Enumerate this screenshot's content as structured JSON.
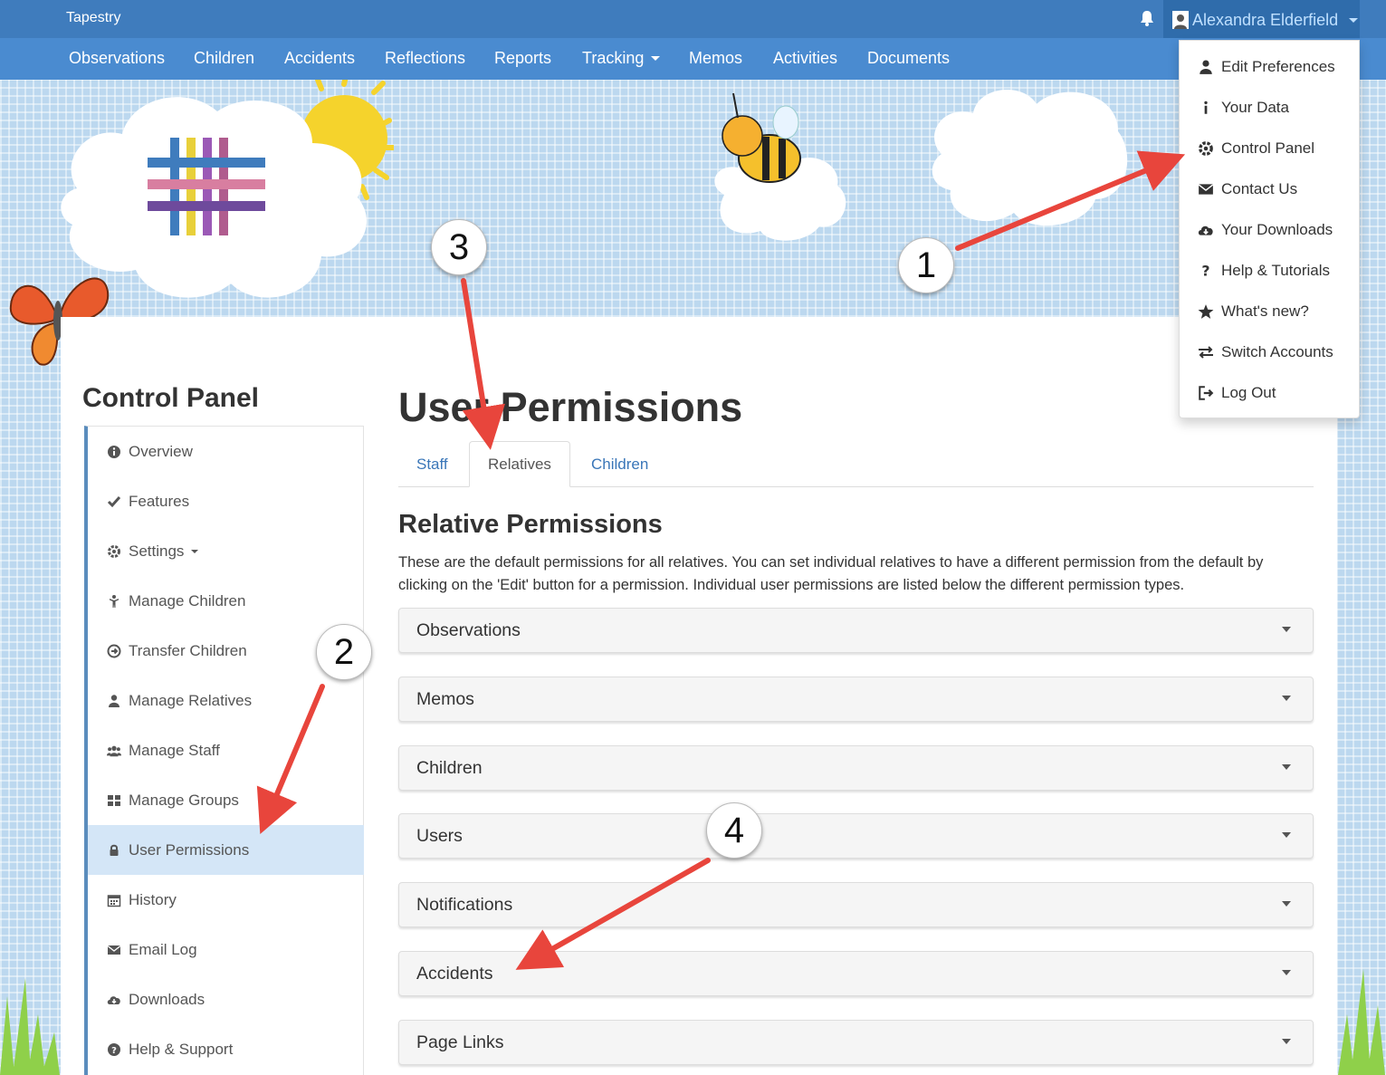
{
  "app": {
    "brand": "Tapestry"
  },
  "user": {
    "name": "Alexandra Elderfield"
  },
  "nav": {
    "items": [
      "Observations",
      "Children",
      "Accidents",
      "Reflections",
      "Reports",
      "Tracking",
      "Memos",
      "Activities",
      "Documents"
    ]
  },
  "user_menu": {
    "items": [
      "Edit Preferences",
      "Your Data",
      "Control Panel",
      "Contact Us",
      "Your Downloads",
      "Help & Tutorials",
      "What's new?",
      "Switch Accounts",
      "Log Out"
    ]
  },
  "sidebar": {
    "title": "Control Panel",
    "items": [
      "Overview",
      "Features",
      "Settings",
      "Manage Children",
      "Transfer Children",
      "Manage Relatives",
      "Manage Staff",
      "Manage Groups",
      "User Permissions",
      "History",
      "Email Log",
      "Downloads",
      "Help & Support"
    ],
    "active": "User Permissions"
  },
  "main": {
    "title": "User Permissions",
    "tabs": [
      "Staff",
      "Relatives",
      "Children"
    ],
    "active_tab": "Relatives",
    "section_title": "Relative Permissions",
    "description": "These are the default permissions for all relatives. You can set individual relatives to have a different permission from the default by clicking on the 'Edit' button for a permission. Individual user permissions are listed below the different permission types.",
    "panels": [
      "Observations",
      "Memos",
      "Children",
      "Users",
      "Notifications",
      "Accidents",
      "Page Links"
    ]
  },
  "annotations": [
    "1",
    "2",
    "3",
    "4"
  ],
  "colors": {
    "topbar": "#3f7cbd",
    "navbar": "#4a8bd0",
    "link": "#3a76b8",
    "arrow": "#e8453c",
    "active_sidebar": "#d4e6f7"
  }
}
